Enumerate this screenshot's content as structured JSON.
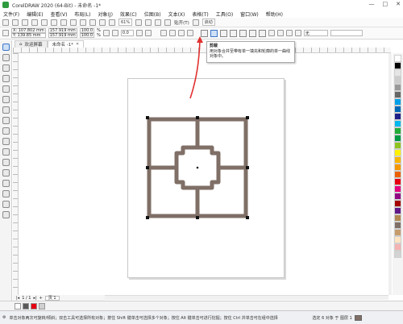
{
  "window": {
    "title": "CorelDRAW 2020 (64-Bit) - 未命名 -1*",
    "controls": [
      "—",
      "□",
      "✕"
    ]
  },
  "menu": {
    "items": [
      "文件(F)",
      "编辑(E)",
      "查看(V)",
      "布局(L)",
      "对象(J)",
      "效果(C)",
      "位图(B)",
      "文本(X)",
      "表格(T)",
      "工具(O)",
      "窗口(W)",
      "帮助(H)"
    ]
  },
  "standard_toolbar": {
    "zoom": "61%",
    "snap_label": "贴齐(T)",
    "launch_label": "启动"
  },
  "property_bar": {
    "x_label": "X:",
    "x_value": "107.802 mm",
    "y_label": "Y:",
    "y_value": "139.85 mm",
    "w_value": "157.919 mm",
    "h_value": "157.919 mm",
    "scale_w": "100.0",
    "scale_h": "100.0",
    "pct": "%",
    "rotation": "0.0",
    "outline_width": "无"
  },
  "tabs": {
    "welcome": "欢迎屏幕",
    "document": "未命名 -1*"
  },
  "tooltip": {
    "title": "剪裁",
    "body": "用对象合并至带有单一填充和轮廓的单一曲线对象中。"
  },
  "page_nav": {
    "counter": "1 / 1",
    "tab": "页 1"
  },
  "status": {
    "hint": "单击对象两次可旋转/倾斜；双击工具可选择所有对象；按住 Shift 键单击可选择多个对象；按住 Alt 键单击可进行挖掘；按住 Ctrl 并单击可在组中选择",
    "selection": "选定 6 对象 于 图层 1"
  },
  "colors": {
    "accent": "#3b76c8",
    "shape_stroke": "#7f6f66",
    "arrow": "#e0312f",
    "palette": [
      "#ffffff",
      "#000000",
      "#e5e5e5",
      "#cccccc",
      "#999999",
      "#666666",
      "#00a0e9",
      "#0068b7",
      "#1d2088",
      "#00b7ee",
      "#22ac38",
      "#009944",
      "#8fc31f",
      "#fff100",
      "#f8b500",
      "#f39800",
      "#eb6100",
      "#e60012",
      "#e4007f",
      "#920783",
      "#a40000",
      "#601986",
      "#b28850",
      "#7f6f66",
      "#c69c6d",
      "#ffe4c4",
      "#f5b2b2",
      "#d3d3d3"
    ],
    "color_bar": [
      "#ffffff",
      "#5a5a5a",
      "#e60012",
      "#d0d0d0"
    ],
    "fill": "#7f6f66"
  }
}
